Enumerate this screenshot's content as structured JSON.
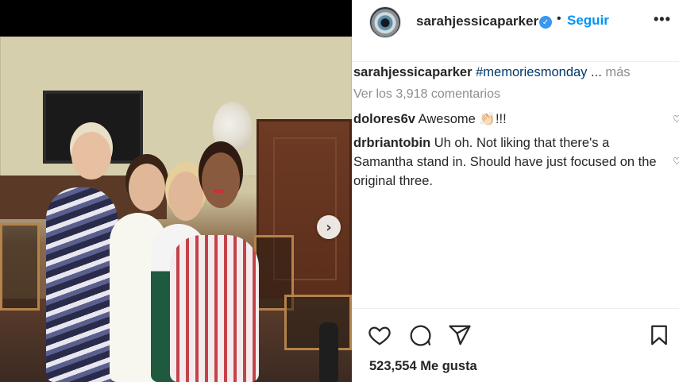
{
  "post": {
    "username": "sarahjessicaparker",
    "verified_icon": "verified-badge-icon",
    "separator": "•",
    "follow_label": "Seguir",
    "more_options": "•••",
    "next_arrow": "›"
  },
  "caption": {
    "username": "sarahjessicaparker",
    "hashtag": "#memoriesmonday",
    "ellipsis": "...",
    "more_label": "más"
  },
  "view_comments": "Ver los 3,918 comentarios",
  "comments": [
    {
      "username": "dolores6v",
      "text": "Awesome",
      "emoji": "👏🏻",
      "suffix": "!!!"
    },
    {
      "username": "drbriantobin",
      "text": "Uh oh. Not liking that there's a Samantha stand in. Should have just focused on the original three."
    }
  ],
  "likes": "523,554 Me gusta",
  "colors": {
    "accent": "#0095f6",
    "hashtag": "#00376b",
    "muted": "#8e8e8e",
    "verified": "#3897f0"
  }
}
